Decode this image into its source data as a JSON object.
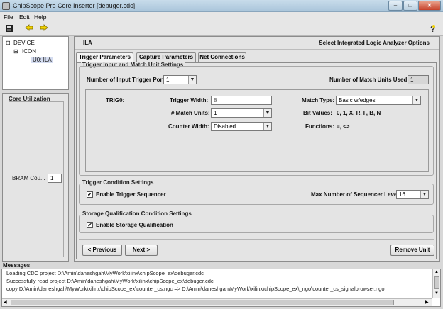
{
  "window": {
    "title": "ChipScope Pro Core Inserter [debuger.cdc]"
  },
  "window_controls": {
    "minimize": "–",
    "maximize": "□",
    "close": "✕"
  },
  "menu": [
    "File",
    "Edit",
    "Help"
  ],
  "toolbar": {
    "save_icon": "save-icon",
    "back_icon": "arrow-left-icon",
    "forward_icon": "arrow-right-icon",
    "help_icon": "help-icon"
  },
  "tree": {
    "root": "DEVICE",
    "child": "ICON",
    "leaf": "U0: ILA"
  },
  "core_utilization": {
    "title": "Core Utilization",
    "row_label": "BRAM Cou...",
    "row_value": "1"
  },
  "header": {
    "left": "ILA",
    "right": "Select Integrated Logic Analyzer Options"
  },
  "tabs": [
    "Trigger Parameters",
    "Capture Parameters",
    "Net Connections"
  ],
  "trigger_input": {
    "title": "Trigger Input and Match Unit Settings",
    "ports_label": "Number of Input Trigger Ports:",
    "ports_value": "1",
    "match_units_used_label": "Number of Match Units Used:",
    "match_units_used_value": "1",
    "trig_name": "TRIG0:",
    "width_label": "Trigger Width:",
    "width_value": "8",
    "match_type_label": "Match Type:",
    "match_type_value": "Basic w/edges",
    "match_units_label": "# Match Units:",
    "match_units_value": "1",
    "bit_values_label": "Bit Values:",
    "bit_values_value": "0, 1, X, R, F, B, N",
    "counter_width_label": "Counter Width:",
    "counter_width_value": "Disabled",
    "functions_label": "Functions:",
    "functions_value": "=, <>"
  },
  "trigger_condition": {
    "title": "Trigger Condition Settings",
    "enable_label": "Enable Trigger Sequencer",
    "enable_checked": "✔",
    "max_levels_label": "Max Number of Sequencer Levels:",
    "max_levels_value": "16"
  },
  "storage": {
    "title": "Storage Qualification Condition Settings",
    "enable_label": "Enable Storage Qualification",
    "enable_checked": "✔"
  },
  "buttons": {
    "previous": "< Previous",
    "next": "Next >",
    "remove": "Remove Unit"
  },
  "messages": {
    "title": "Messages",
    "lines": [
      "Loading CDC project D:\\Amin\\daneshgah\\MyWork\\xilinx\\chipScope_ex\\debuger.cdc",
      "Successfully read project D:\\Amin\\daneshgah\\MyWork\\xilinx\\chipScope_ex\\debuger.cdc",
      "copy D:\\Amin\\daneshgah\\MyWork\\xilinx\\chipScope_ex\\counter_cs.ngc => D:\\Amin\\daneshgah\\MyWork\\xilinx\\chipScope_ex\\_ngo\\counter_cs_signalbrowser.ngo"
    ]
  },
  "arrows": {
    "down": "▼",
    "up": "▲",
    "left": "◀",
    "right": "▶"
  }
}
